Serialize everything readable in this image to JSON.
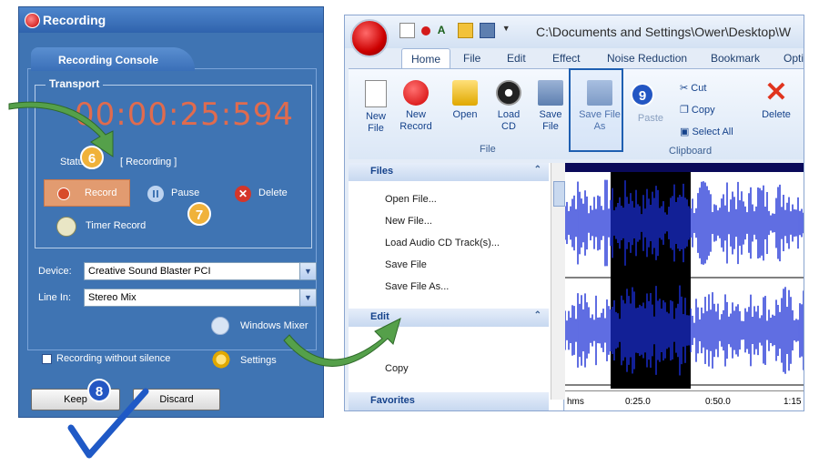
{
  "recording_window": {
    "title": "Recording",
    "console_tab": "Recording Console",
    "transport_label": "Transport",
    "time": "00:00:25:594",
    "status_label": "Status:",
    "status_value": "[ Recording ]",
    "record_label": "Record",
    "pause_label": "Pause",
    "delete_label": "Delete",
    "timer_record_label": "Timer Record",
    "device_label": "Device:",
    "device_value": "Creative Sound Blaster PCI",
    "line_in_label": "Line In:",
    "line_in_value": "Stereo Mix",
    "windows_mixer_label": "Windows Mixer",
    "recording_without_silence_label": "Recording without silence",
    "settings_label": "Settings",
    "keep_label": "Keep",
    "discard_label": "Discard"
  },
  "badges": [
    "6",
    "7",
    "8",
    "9"
  ],
  "editor_window": {
    "title": "C:\\Documents and Settings\\Ower\\Desktop\\W",
    "tabs": [
      "Home",
      "File",
      "Edit",
      "Effect",
      "Noise Reduction",
      "Bookmark",
      "Opti"
    ],
    "active_tab": "Home",
    "ribbon_buttons": [
      {
        "label": "New File",
        "icon": "new-file-icon"
      },
      {
        "label": "New Record",
        "icon": "record-icon"
      },
      {
        "label": "Open",
        "icon": "folder-icon"
      },
      {
        "label": "Load CD",
        "icon": "cd-icon"
      },
      {
        "label": "Save File",
        "icon": "save-icon"
      },
      {
        "label": "Save File As",
        "icon": "save-as-icon"
      }
    ],
    "group_file_label": "File",
    "paste_label": "Paste",
    "clipboard_items": [
      "Cut",
      "Copy",
      "Select All"
    ],
    "group_clipboard_label": "Clipboard",
    "delete_label": "Delete",
    "panel_files_header": "Files",
    "panel_files_items": [
      "Open File...",
      "New File...",
      "Load Audio CD Track(s)...",
      "Save File",
      "Save File As..."
    ],
    "panel_edit_header": "Edit",
    "panel_edit_items": [
      "Copy"
    ],
    "panel_favorites_header": "Favorites",
    "ruler_labels": [
      "hms",
      "0:25.0",
      "0:50.0",
      "1:15"
    ]
  },
  "colors": {
    "console_blue": "#3f74b3",
    "time_orange": "#e06b4e",
    "wave_blue": "#1b2fd6",
    "selection_black": "#000000",
    "badge_yellow": "#f0b23a",
    "badge_blue": "#2356c3"
  }
}
